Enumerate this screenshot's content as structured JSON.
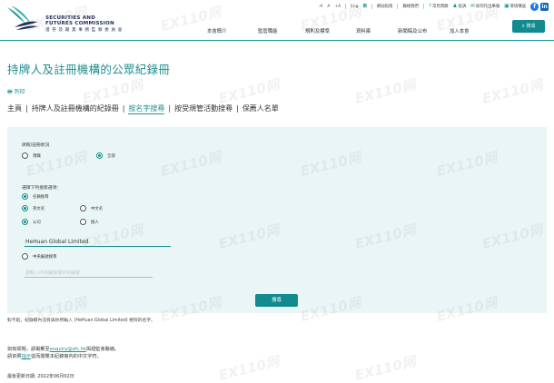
{
  "header": {
    "logo": {
      "line1": "SECURITIES AND",
      "line2": "FUTURES COMMISSION",
      "line3": "證 券 及 期 貨 事 務 監 察 委 員 會"
    },
    "utility": [
      {
        "label": "-A",
        "icon": ""
      },
      {
        "label": "A",
        "icon": ""
      },
      {
        "label": "+A",
        "icon": ""
      },
      {
        "label": "Eng",
        "icon": ""
      },
      {
        "label": "简",
        "icon": ""
      },
      {
        "label": "網站指南",
        "icon": ""
      },
      {
        "label": "聯絡我們",
        "icon": ""
      },
      {
        "label": "常見問題",
        "icon": "?"
      },
      {
        "label": "投訴",
        "icon": "♟"
      },
      {
        "label": "如何作出舉報",
        "icon": "✉"
      },
      {
        "label": "環境傳送",
        "icon": "▣"
      }
    ],
    "social": [
      "f",
      "in"
    ],
    "nav": [
      "本會簡介",
      "監管職能",
      "規則及標準",
      "資料庫",
      "新聞稿及公布",
      "加入本會"
    ],
    "search_button": "搜尋"
  },
  "page": {
    "title": "持牌人及註冊機構的公眾紀錄冊",
    "print": "列印",
    "breadcrumbs": [
      "主頁",
      "持牌人及註冊機構的紀錄冊",
      "按名字搜尋",
      "按受規管活動搜尋",
      "保薦人名單"
    ],
    "active_crumb": "按名字搜尋"
  },
  "form": {
    "status_label": "牌照/註冊狀況",
    "status_options": [
      {
        "label": "現職",
        "checked": false
      },
      {
        "label": "全部",
        "checked": true
      }
    ],
    "criteria_label": "選擇下列搜索選項：",
    "by_name_label": "名稱搜尋",
    "lang_options": [
      {
        "label": "英文名",
        "checked": true
      },
      {
        "label": "中文名",
        "checked": false
      }
    ],
    "type_options": [
      {
        "label": "公司",
        "checked": true
      },
      {
        "label": "個人",
        "checked": false
      }
    ],
    "name_value": "HeHuan Global Limited",
    "ce_label": "中央編號搜尋",
    "ce_placeholder": "請輸入中央編號或中央編號",
    "submit": "搜尋"
  },
  "messages": {
    "no_result": "對不起，紀錄冊內沒有與你所輸入 (HeHuan Global Limited) 相符的名字。",
    "enquiry_prefix": "如有問題，請電郵至",
    "enquiry_email": "enquiry@sfc.hk",
    "enquiry_suffix": "與證監會聯絡。",
    "help_prefix": "請依照",
    "help_link": "指示",
    "help_suffix": "從而閱覽本紀錄冊內的中文字符。",
    "last_updated": "最後更新日期: 2022年06月02日"
  },
  "watermark": "EX110网",
  "colors": {
    "accent": "#128b8f",
    "title": "#1f8f8f",
    "panel": "#eaf6f6",
    "logo": "#1d2e57"
  }
}
